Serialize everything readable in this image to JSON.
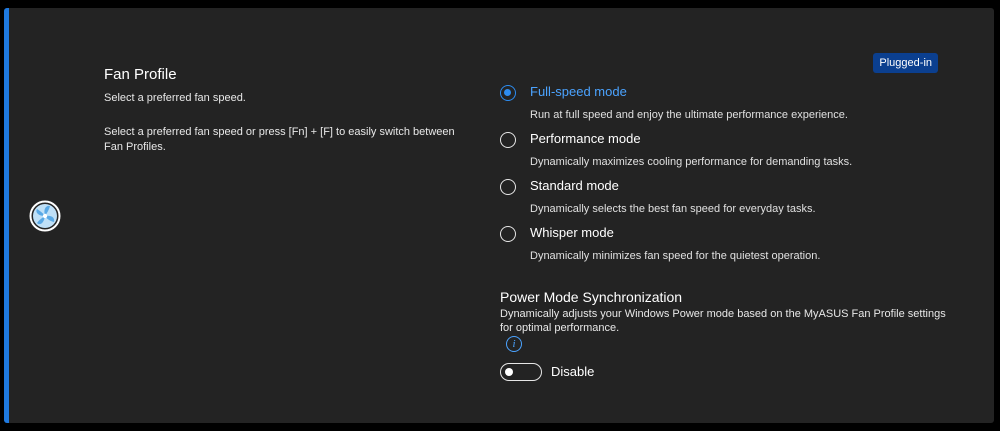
{
  "fan_profile": {
    "title": "Fan Profile",
    "subtitle": "Select a preferred fan speed.",
    "hint": "Select a preferred fan speed or press [Fn] + [F]  to easily switch between Fan Profiles.",
    "status_badge": "Plugged-in",
    "selected": "Full-speed mode",
    "options": [
      {
        "label": "Full-speed mode",
        "description": "Run at full speed and enjoy the ultimate performance experience."
      },
      {
        "label": "Performance mode",
        "description": "Dynamically maximizes cooling performance for demanding tasks."
      },
      {
        "label": "Standard mode",
        "description": "Dynamically selects the best fan speed for everyday tasks."
      },
      {
        "label": "Whisper mode",
        "description": "Dynamically minimizes fan speed for the quietest operation."
      }
    ]
  },
  "power_sync": {
    "title": "Power Mode Synchronization",
    "description": "Dynamically adjusts your Windows Power mode based on the MyASUS Fan Profile settings for optimal performance.",
    "toggle_state": "Disable"
  },
  "colors": {
    "accent": "#1f7ae0",
    "selected": "#2d8cf0",
    "badge": "#0b3f8f",
    "card": "#232323"
  }
}
